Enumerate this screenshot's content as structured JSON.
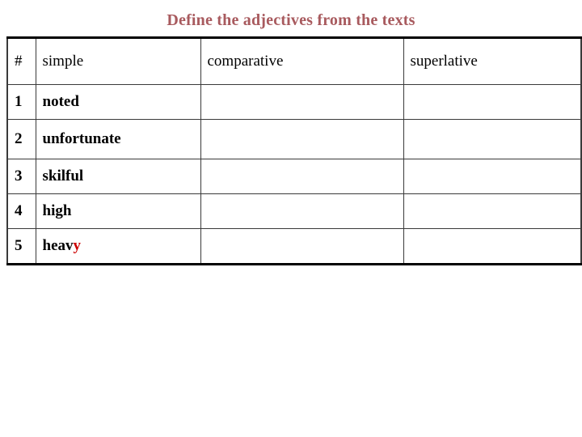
{
  "slide": {
    "title": "Define the adjectives from the texts",
    "title_color": "#a85a5e"
  },
  "table": {
    "columns": [
      {
        "key": "num",
        "label": "#"
      },
      {
        "key": "simple",
        "label": "simple"
      },
      {
        "key": "comparative",
        "label": "comparative"
      },
      {
        "key": "superlative",
        "label": "superlative"
      }
    ],
    "rows": [
      {
        "num": "1",
        "simple": "noted",
        "simple_head": "noted",
        "simple_tail": "",
        "comparative": "",
        "superlative": ""
      },
      {
        "num": "2",
        "simple": "unfortunate",
        "simple_head": "unfortunate",
        "simple_tail": "",
        "comparative": "",
        "superlative": ""
      },
      {
        "num": "3",
        "simple": "skilful",
        "simple_head": "skilful",
        "simple_tail": "",
        "comparative": "",
        "superlative": ""
      },
      {
        "num": "4",
        "simple": "high",
        "simple_head": "high",
        "simple_tail": "",
        "comparative": "",
        "superlative": ""
      },
      {
        "num": "5",
        "simple": "heavy",
        "simple_head": "heav",
        "simple_tail": "y",
        "comparative": "",
        "superlative": ""
      }
    ],
    "highlight_color": "#cc0000"
  }
}
